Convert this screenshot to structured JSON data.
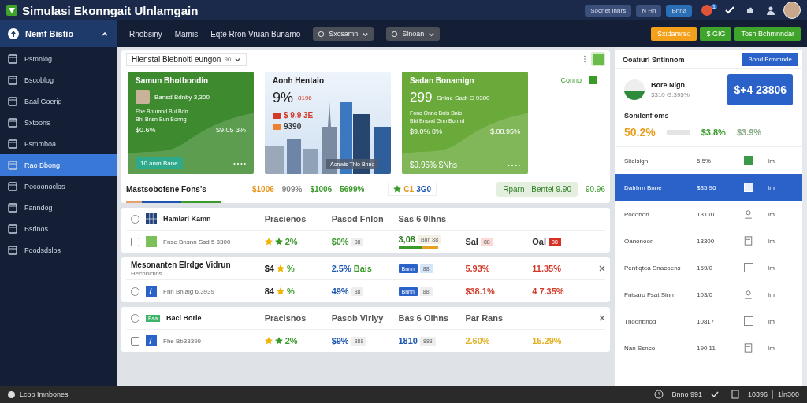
{
  "app": {
    "title": "Simulasi Ekonngait Ulnlamgain",
    "top_buttons": [
      {
        "label": "Sochet Ihnrs",
        "kind": "plain"
      },
      {
        "label": "N Hn",
        "kind": "plain"
      },
      {
        "label": "Bnna",
        "kind": "primary"
      }
    ],
    "badge": "1"
  },
  "nav": {
    "sidebar_title": "Nemf Bistio",
    "links": [
      "Rnobsiny",
      "Mamis",
      "Eqte Rron Vruan Bunamo"
    ],
    "dropdowns": [
      "Sxcsamn",
      "Slnoan"
    ],
    "actions": [
      {
        "label": "Sxidamrso",
        "color": "#f5a01a"
      },
      {
        "label": "$ GIG",
        "color": "#3fa52a"
      },
      {
        "label": "Tosh Bchmnndar",
        "color": "#3fa52a"
      }
    ]
  },
  "sidebar": {
    "items": [
      {
        "label": "Psmniog",
        "selected": false
      },
      {
        "label": "Bscoblog",
        "selected": false
      },
      {
        "label": "Baal Goerig",
        "selected": false
      },
      {
        "label": "Sxtoons",
        "selected": false
      },
      {
        "label": "Fsmmboa",
        "selected": false
      },
      {
        "label": "Rao Bbong",
        "selected": true
      },
      {
        "label": "Pocoonoclos",
        "selected": false
      },
      {
        "label": "Fanndog",
        "selected": false
      },
      {
        "label": "Bsrlnos",
        "selected": false
      },
      {
        "label": "Foodsdslos",
        "selected": false
      }
    ]
  },
  "panel": {
    "title": "Hlenstal Blebnoitl eungon",
    "filter": "90",
    "link": "Conno",
    "link_checked": true
  },
  "cards": [
    {
      "kind": "chart",
      "title": "Samun Bhotbondin",
      "avatar": true,
      "subtitle": "Bansd Bdnby 3,300",
      "lines": [
        "Fhe Bnumnd Bui Bdn",
        "Bhi Bnsn Bun Bonng"
      ],
      "left_value": "$0.6%",
      "right_value": "$9.05 3%",
      "button": "10 anm Bane",
      "dots": "• • • •",
      "color": "#3d8b2e"
    },
    {
      "kind": "photo",
      "title": "Aonh Hentaio",
      "headline": "9%",
      "note": "8196",
      "lines": [
        {
          "text": "$ 9.9 3E",
          "color": "#d23a2a"
        },
        {
          "text": "9390",
          "color": "#333333"
        }
      ],
      "caption": "Aonwis Thlo Bnno"
    },
    {
      "kind": "chart",
      "title": "Sadan Bonamign",
      "avatar": false,
      "headline": "299",
      "subtitle": "Snine Sadt C 9300",
      "lines": [
        "Fonc Onno Bnis Bnio",
        "Bhi Bnsnd Gnn Bonnd"
      ],
      "left_value": "$9.0% 8%",
      "right_value": "$.08.95%",
      "bottom": "$9.96% $Nhs",
      "dots": "• • • •",
      "color": "#6aaa3a"
    }
  ],
  "summary": {
    "title": "Mastsobofsne Fons's",
    "values": [
      {
        "text": "$1006",
        "color": "#e8961a"
      },
      {
        "text": "909%",
        "color": "#888888"
      },
      {
        "text": "$1006",
        "color": "#3a9a2a"
      },
      {
        "text": "5699%",
        "color": "#3a9a2a"
      }
    ],
    "rating": "C1",
    "rating_value": "3G0",
    "pill": "Rparn - Bentel 9.90",
    "end": "90.96"
  },
  "groups": [
    {
      "rows": [
        {
          "kind": "grid-header",
          "checked": false,
          "name": "Hamlarl Kamn",
          "closable": false,
          "columns": [
            [
              {
                "kind": "text",
                "text": "Pracienos",
                "color": "#555555"
              }
            ],
            [
              {
                "kind": "text",
                "text": "Pasod Fnlon",
                "color": "#555555"
              }
            ],
            [
              {
                "kind": "text",
                "text": "Sas 6 0lhns",
                "color": "#555555"
              }
            ],
            [],
            []
          ]
        },
        {
          "kind": "square-item",
          "checked": false,
          "name": "Fnse Bnsnn Ssd 5 3300",
          "closable": false,
          "columns": [
            [
              {
                "kind": "star",
                "color": "#f0b400"
              },
              {
                "kind": "star",
                "color": "#3a9a2a"
              },
              {
                "kind": "text",
                "text": "2%",
                "color": "#3a9a2a"
              }
            ],
            [
              {
                "kind": "text",
                "text": "$0%",
                "color": "#3a9a2a"
              },
              {
                "kind": "chip",
                "text": "88",
                "color": "#eeeeee"
              }
            ],
            [
              {
                "kind": "text",
                "text": "3,08",
                "color": "#2e7d22"
              },
              {
                "kind": "chip",
                "text": "Bnn 88",
                "color": "#f5f0e6"
              },
              {
                "kind": "bar",
                "level": 0.6
              }
            ],
            [
              {
                "kind": "text",
                "text": "Sal",
                "color": "#333333"
              },
              {
                "kind": "chip",
                "text": "88",
                "color": "#fbd9d6"
              }
            ],
            [
              {
                "kind": "text",
                "text": "Oal",
                "color": "#333333"
              },
              {
                "kind": "badge",
                "text": "88",
                "color": "#d93025"
              }
            ]
          ]
        }
      ]
    },
    {
      "title": "Mesonanten Elrdge Vidrun",
      "subtitle": "Hecbnidlns",
      "rows": [
        {
          "kind": "title",
          "name": "",
          "closable": true,
          "columns": [
            [
              {
                "kind": "text",
                "text": "$4",
                "color": "#222222"
              },
              {
                "kind": "star",
                "color": "#f0b400"
              },
              {
                "kind": "text",
                "text": "%",
                "color": "#3a9a2a"
              }
            ],
            [
              {
                "kind": "text",
                "text": "2.5%",
                "color": "#1e56b0"
              },
              {
                "kind": "text",
                "text": "Bais",
                "color": "#3a9a2a"
              }
            ],
            [
              {
                "kind": "badge",
                "text": "Bnnn",
                "color": "#2a62c9"
              },
              {
                "kind": "chip",
                "text": "88",
                "color": "#d6e4f7"
              }
            ],
            [
              {
                "kind": "text",
                "text": "5.93%",
                "color": "#d23a2a"
              }
            ],
            [
              {
                "kind": "text",
                "text": "11.35%",
                "color": "#d23a2a"
              }
            ]
          ]
        },
        {
          "kind": "doc-radio",
          "checked": false,
          "name": "Fhn Bniaig 6.3939",
          "closable": false,
          "columns": [
            [
              {
                "kind": "text",
                "text": "84",
                "color": "#222222"
              },
              {
                "kind": "star",
                "color": "#f0b400"
              },
              {
                "kind": "text",
                "text": "%",
                "color": "#3a9a2a"
              }
            ],
            [
              {
                "kind": "text",
                "text": "49%",
                "color": "#1e56b0"
              },
              {
                "kind": "chip",
                "text": "88",
                "color": "#eeeeee"
              }
            ],
            [
              {
                "kind": "badge",
                "text": "Bnnn",
                "color": "#2a62c9"
              },
              {
                "kind": "chip",
                "text": "88",
                "color": "#eeeeee"
              }
            ],
            [
              {
                "kind": "text",
                "text": "$38.1%",
                "color": "#d23a2a"
              }
            ],
            [
              {
                "kind": "text",
                "text": "4 7.35%",
                "color": "#d23a2a"
              }
            ]
          ]
        }
      ]
    },
    {
      "rows": [
        {
          "kind": "tag-header",
          "checked": false,
          "tag": "Bsa",
          "name": "Bacl Borle",
          "closable": true,
          "columns": [
            [
              {
                "kind": "text",
                "text": "Pracisnos",
                "color": "#555555"
              }
            ],
            [
              {
                "kind": "text",
                "text": "Pasob Viriyy",
                "color": "#555555"
              }
            ],
            [
              {
                "kind": "text",
                "text": "Bas 6 Olhns",
                "color": "#555555"
              }
            ],
            [
              {
                "kind": "text",
                "text": "Par Rans",
                "color": "#555555"
              }
            ],
            []
          ]
        },
        {
          "kind": "doc-check",
          "checked": false,
          "name": "Fhe Bb33399",
          "closable": false,
          "columns": [
            [
              {
                "kind": "star",
                "color": "#f0b400"
              },
              {
                "kind": "star",
                "color": "#3a9a2a"
              },
              {
                "kind": "text",
                "text": "2%",
                "color": "#3a9a2a"
              }
            ],
            [
              {
                "kind": "text",
                "text": "$9%",
                "color": "#1e56b0"
              },
              {
                "kind": "chip",
                "text": "888",
                "color": "#eeeeee"
              }
            ],
            [
              {
                "kind": "text",
                "text": "1810",
                "color": "#1e56b0"
              },
              {
                "kind": "chip",
                "text": "888",
                "color": "#eeeeee"
              }
            ],
            [
              {
                "kind": "text",
                "text": "2.60%",
                "color": "#e0b020"
              }
            ],
            [
              {
                "kind": "text",
                "text": "15.29%",
                "color": "#e0b020"
              }
            ]
          ]
        }
      ]
    }
  ],
  "side": {
    "title": "Ooatiurl Sntlnnom",
    "button": "Bnnd Brmmnde",
    "profile_name": "Bore Nign",
    "profile_note": "3310 G.395%",
    "tile": "$+4 23806",
    "section": "Sonilenf oms",
    "stats": [
      {
        "text": "50.2%",
        "color": "#e8a020"
      },
      {
        "text": "$3.8%",
        "color": "#3a9a2a"
      },
      {
        "text": "$3.9%",
        "color": "#7fa87f"
      }
    ],
    "rows": [
      {
        "name": "Sitelsign",
        "value": "5.5%",
        "kind": "filled",
        "unit": "Im",
        "selected": false
      },
      {
        "name": "Dafrbrn Bnne",
        "value": "$35.96",
        "kind": "box",
        "unit": "Im",
        "selected": true
      },
      {
        "name": "Pocobon",
        "value": "13.0/0",
        "kind": "glyph",
        "unit": "Im",
        "selected": false
      },
      {
        "name": "Oanonoon",
        "value": "13300",
        "kind": "doc",
        "unit": "Im",
        "selected": false
      },
      {
        "name": "Pentiqtea Snacoens",
        "value": "159/0",
        "kind": "box",
        "unit": "Im",
        "selected": false
      },
      {
        "name": "Fnisaro Fsat Sinrn",
        "value": "103/0",
        "kind": "glyph",
        "unit": "Im",
        "selected": false
      },
      {
        "name": "Tnodnbnod",
        "value": "10817",
        "kind": "box",
        "unit": "Im",
        "selected": false
      },
      {
        "name": "Nan Ssnco",
        "value": "190.11",
        "kind": "doc",
        "unit": "Im",
        "selected": false
      }
    ]
  },
  "status": {
    "left": "Lcoo Imnbones",
    "items": [
      "Bnno 991",
      "10396"
    ],
    "right": "1ln300"
  }
}
